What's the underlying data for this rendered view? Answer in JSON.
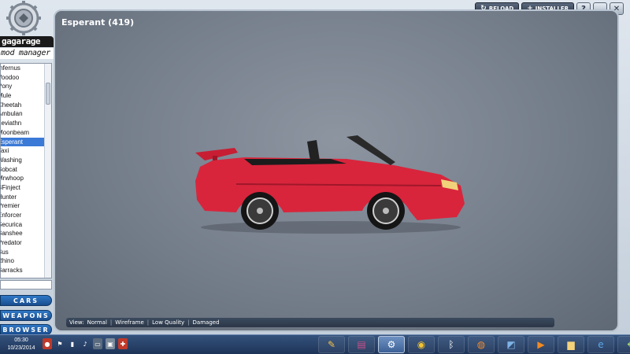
{
  "app": {
    "logo_title": "gagarage",
    "logo_subtitle": "mod manager"
  },
  "topbar": {
    "reload_label": "RELOAD",
    "installer_label": "INSTALLER",
    "extra_glyph": "?",
    "minimize_glyph": "_",
    "close_glyph": "✕"
  },
  "sidebar": {
    "vehicles": [
      "Infernus",
      "Voodoo",
      "Pony",
      "Mule",
      "Cheetah",
      "Ambulan",
      "Leviathn",
      "Moonbeam",
      "Esperant",
      "Taxi",
      "Washing",
      "Bobcat",
      "Mrwhoop",
      "BFinject",
      "Hunter",
      "Premier",
      "Enforcer",
      "Securica",
      "Banshee",
      "Predator",
      "Bus",
      "Rhino",
      "Barracks"
    ],
    "selected_vehicle": "Esperant",
    "search_value": "",
    "categories": [
      "CARS",
      "WEAPONS",
      "BROWSER"
    ]
  },
  "viewport": {
    "title": "Esperant (419)",
    "view_label": "View:",
    "view_modes": [
      "Normal",
      "Wireframe",
      "Low Quality",
      "Damaged"
    ],
    "car_color": "#d8253c"
  },
  "taskbar": {
    "time": "05:30",
    "date": "10/23/2014"
  }
}
